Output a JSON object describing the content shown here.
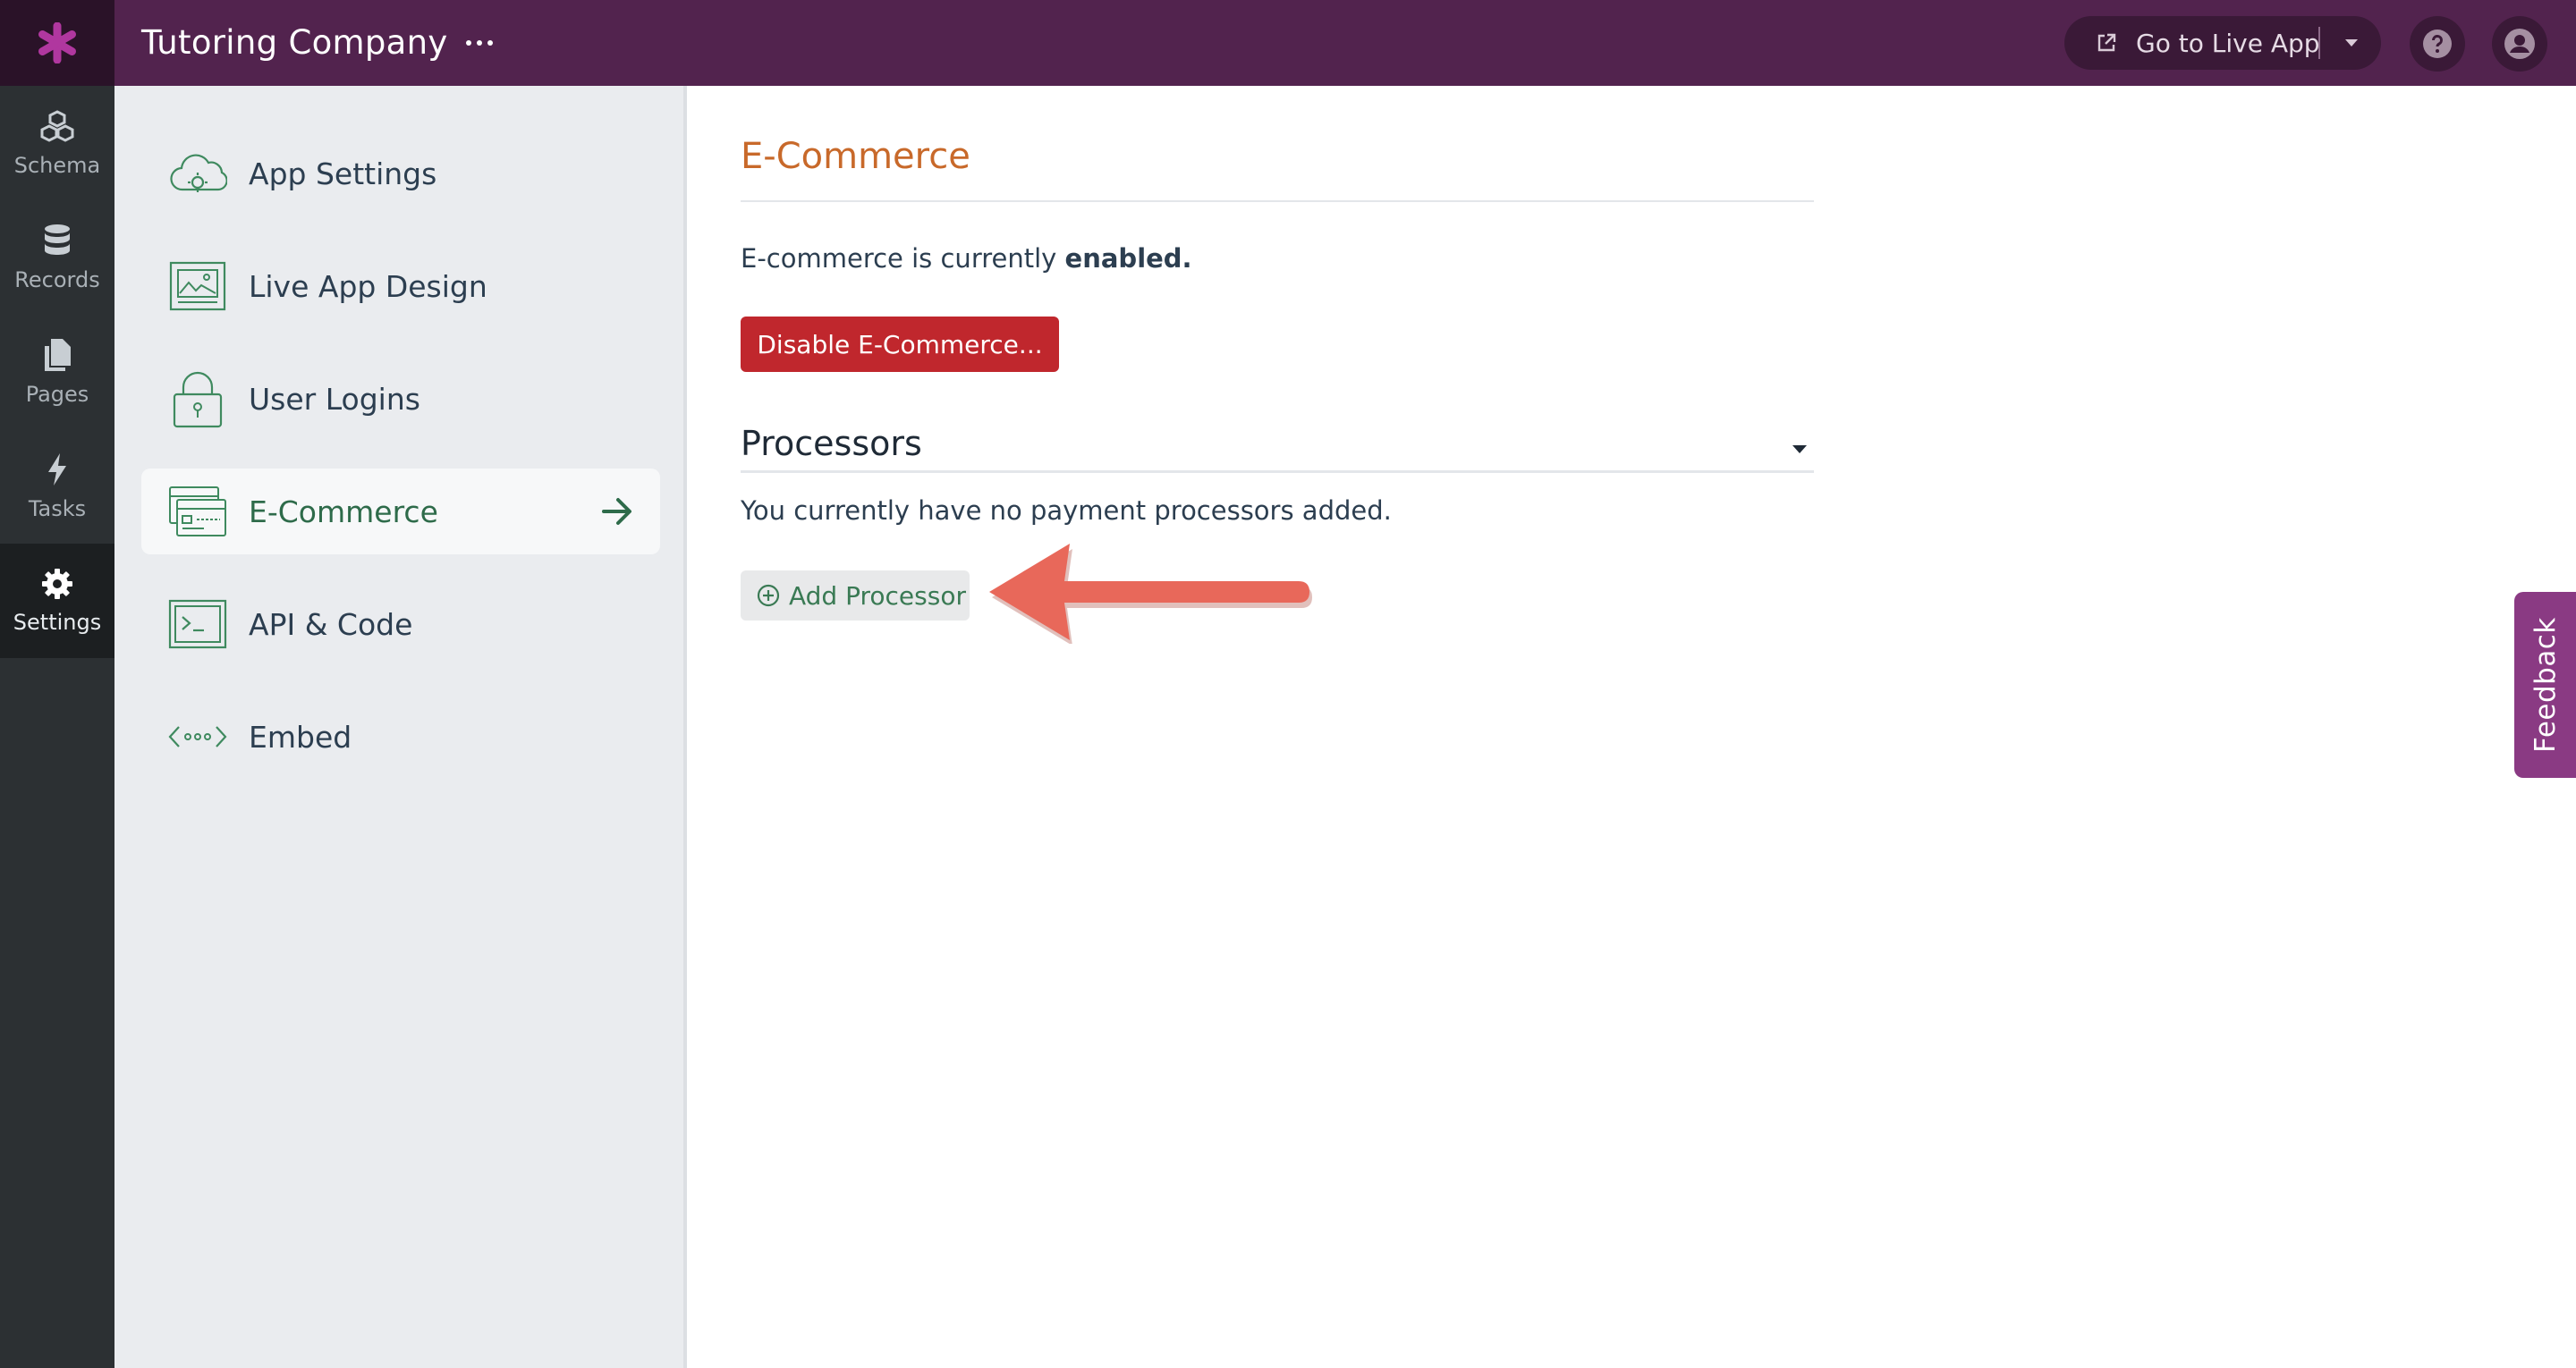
{
  "app": {
    "title": "Tutoring Company",
    "more_icon": "more-horizontal-icon",
    "accent_color": "#52234e"
  },
  "header": {
    "live_app_label": "Go to Live App",
    "help_icon": "question-circle-icon",
    "account_icon": "user-circle-icon"
  },
  "rail": {
    "items": [
      {
        "label": "Schema",
        "icon": "schema-cubes-icon"
      },
      {
        "label": "Records",
        "icon": "database-icon"
      },
      {
        "label": "Pages",
        "icon": "pages-icon"
      },
      {
        "label": "Tasks",
        "icon": "bolt-icon"
      },
      {
        "label": "Settings",
        "icon": "gear-icon",
        "active": true
      }
    ]
  },
  "settings_nav": {
    "items": [
      {
        "label": "App Settings",
        "icon": "cloud-gear-icon"
      },
      {
        "label": "Live App Design",
        "icon": "image-frame-icon"
      },
      {
        "label": "User Logins",
        "icon": "padlock-icon"
      },
      {
        "label": "E-Commerce",
        "icon": "credit-card-icon",
        "active": true
      },
      {
        "label": "API & Code",
        "icon": "terminal-icon"
      },
      {
        "label": "Embed",
        "icon": "embed-code-icon"
      }
    ]
  },
  "main": {
    "title": "E-Commerce",
    "status_prefix": "E-commerce is currently",
    "status_value": "enabled.",
    "disable_button": "Disable E-Commerce...",
    "processors_title": "Processors",
    "processors_empty": "You currently have no payment processors added.",
    "add_processor_button": "Add Processor"
  },
  "feedback": {
    "label": "Feedback"
  },
  "colors": {
    "title_orange": "#c8692a",
    "danger_red": "#c0272d",
    "green": "#2e6b4a",
    "annotation_arrow": "#e8685a"
  }
}
